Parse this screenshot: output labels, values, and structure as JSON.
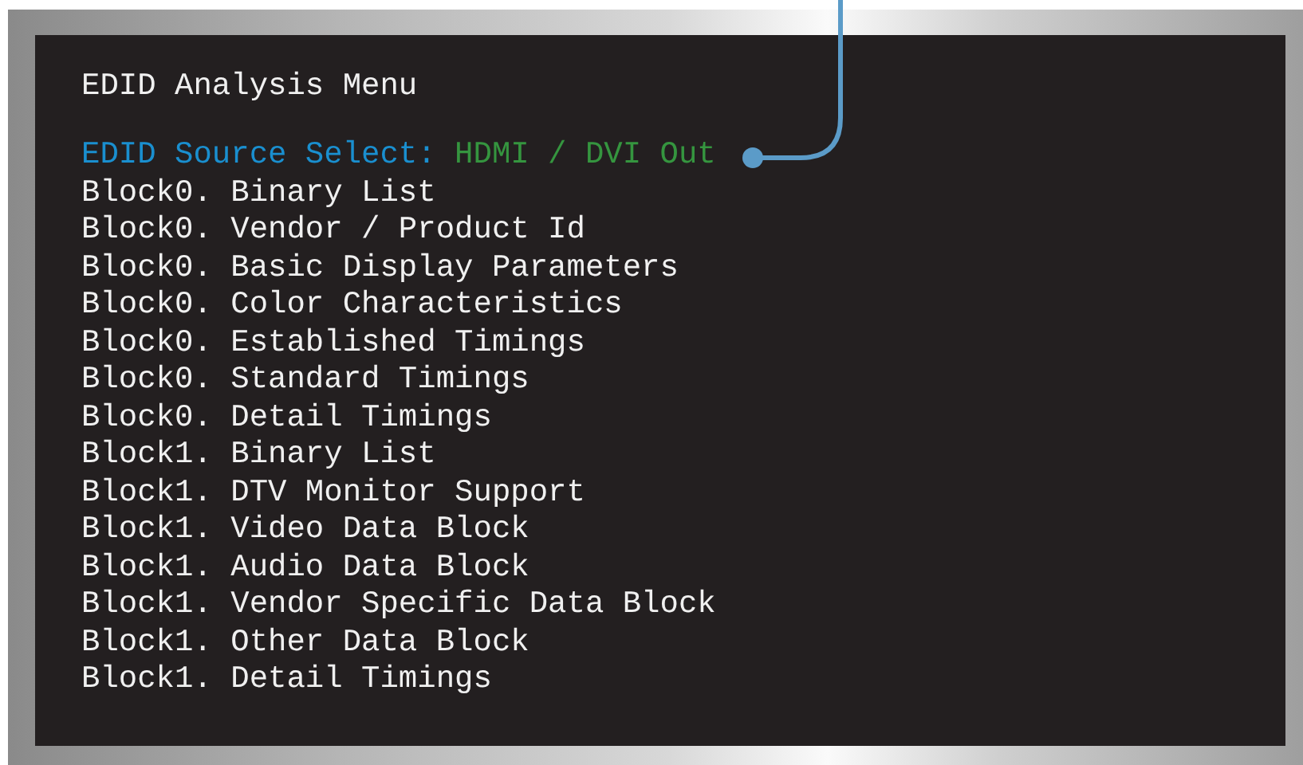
{
  "screen": {
    "title": "EDID Analysis Menu",
    "source": {
      "label": "EDID Source Select:",
      "value": "HDMI / DVI Out"
    },
    "items": [
      "Block0. Binary List",
      "Block0. Vendor / Product Id",
      "Block0. Basic Display Parameters",
      "Block0. Color Characteristics",
      "Block0. Established Timings",
      "Block0. Standard Timings",
      "Block0. Detail Timings",
      "Block1. Binary List",
      "Block1. DTV Monitor Support",
      "Block1. Video Data Block",
      "Block1. Audio Data Block",
      "Block1. Vendor Specific Data Block",
      "Block1. Other Data Block",
      "Block1. Detail Timings"
    ]
  }
}
